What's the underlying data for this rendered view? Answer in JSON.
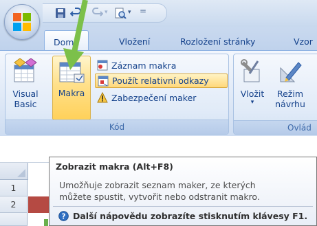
{
  "qat": {
    "separator": "="
  },
  "tabs": [
    {
      "label": "Domů",
      "active": true
    },
    {
      "label": "Vložení",
      "active": false
    },
    {
      "label": "Rozložení stránky",
      "active": false
    },
    {
      "label": "Vzor",
      "active": false
    }
  ],
  "ribbon": {
    "kod_group": {
      "label": "Kód",
      "visual_basic": "Visual\nBasic",
      "visual_basic_l1": "Visual",
      "visual_basic_l2": "Basic",
      "makra": "Makra",
      "zaznam_makra": "Záznam makra",
      "pouzit_relativni": "Použít relativní odkazy",
      "zabezpeceni": "Zabezpečení maker"
    },
    "ovladaci_group": {
      "label": "Ovlád",
      "vlozit": "Vložit",
      "rezim_l1": "Režim",
      "rezim_l2": "návrhu"
    }
  },
  "sheet": {
    "rows": [
      "1",
      "2"
    ]
  },
  "tooltip": {
    "title": "Zobrazit makra (Alt+F8)",
    "desc_l1": "Umožňuje zobrazit seznam maker, ze kterých",
    "desc_l2": "můžete spustit, vytvořit nebo odstranit makro.",
    "help": "Další nápovědu zobrazíte stisknutím klávesy F1."
  },
  "colors": {
    "ribbon_accent": "#15428b",
    "highlight": "#ffd15a",
    "arrow": "#7cc04a"
  }
}
